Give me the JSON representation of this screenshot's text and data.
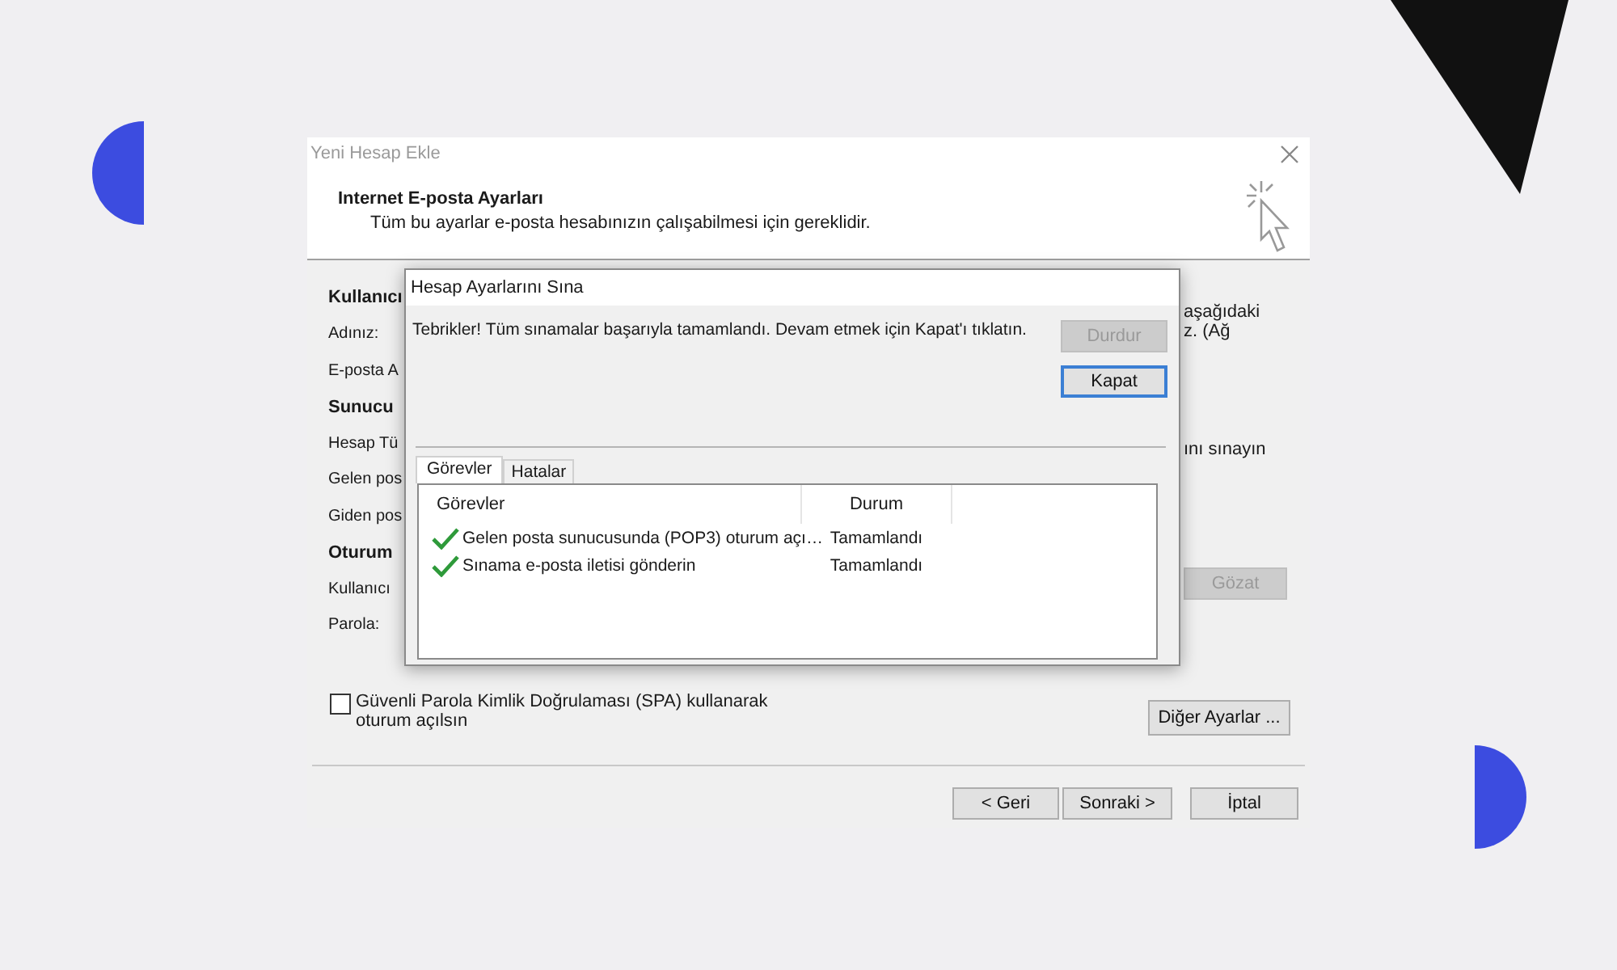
{
  "window": {
    "title": "Yeni Hesap Ekle"
  },
  "header": {
    "title": "Internet E-posta Ayarları",
    "subtitle": "Tüm bu ayarlar e-posta hesabınızın çalışabilmesi için gereklidir."
  },
  "form_left": [
    {
      "text": "Kullanıcı",
      "kind": "heading"
    },
    {
      "text": "Adınız:",
      "kind": "label"
    },
    {
      "text": "E-posta A",
      "kind": "label"
    },
    {
      "text": "Sunucu",
      "kind": "heading"
    },
    {
      "text": "Hesap Tü",
      "kind": "label"
    },
    {
      "text": "Gelen pos",
      "kind": "label"
    },
    {
      "text": "Giden pos",
      "kind": "label"
    },
    {
      "text": "Oturum",
      "kind": "heading"
    },
    {
      "text": "Kullanıcı",
      "kind": "label"
    },
    {
      "text": "Parola:",
      "kind": "label"
    }
  ],
  "form_right": {
    "note_lines": [
      "aşağıdaki",
      "z. (Ağ"
    ],
    "test_hint": "ını sınayın",
    "browse_button": {
      "label": "Gözat",
      "disabled": true
    }
  },
  "spa_checkbox": {
    "label": "Güvenli Parola Kimlik Doğrulaması (SPA) kullanarak oturum açılsın",
    "checked": false
  },
  "more_settings_button": {
    "label": "Diğer Ayarlar ..."
  },
  "nav_buttons": [
    {
      "label": "< Geri"
    },
    {
      "label": "Sonraki >"
    },
    {
      "label": "İptal"
    }
  ],
  "test_dialog": {
    "title": "Hesap Ayarlarını Sına",
    "message": "Tebrikler! Tüm sınamalar başarıyla tamamlandı. Devam etmek için Kapat'ı tıklatın.",
    "buttons": [
      {
        "label": "Durdur",
        "disabled": true,
        "default": false
      },
      {
        "label": "Kapat",
        "disabled": false,
        "default": true
      }
    ],
    "tabs": [
      {
        "label": "Görevler",
        "selected": true
      },
      {
        "label": "Hatalar",
        "selected": false
      }
    ],
    "columns": [
      "Görevler",
      "Durum"
    ],
    "rows": [
      {
        "task": "Gelen posta sunucusunda (POP3) oturum açı…",
        "status": "Tamamlandı",
        "done": true
      },
      {
        "task": "Sınama e-posta iletisi gönderin",
        "status": "Tamamlandı",
        "done": true
      }
    ]
  }
}
